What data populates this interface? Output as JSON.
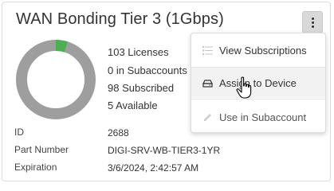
{
  "card": {
    "title": "WAN Bonding Tier 3 (1Gbps)"
  },
  "usage": {
    "total_licenses": 103,
    "subscribed": 98,
    "available": 5,
    "in_subaccounts": 0,
    "colors": {
      "used": "#9e9e9e",
      "available": "#4caf50"
    },
    "lines": [
      "103 Licenses",
      "0 in Subaccounts",
      "98 Subscribed",
      "5 Available"
    ]
  },
  "details": [
    {
      "label": "ID",
      "value": "2688"
    },
    {
      "label": "Part Number",
      "value": "DIGI-SRV-WB-TIER3-1YR"
    },
    {
      "label": "Expiration",
      "value": "3/6/2024, 2:42:57 AM"
    }
  ],
  "menu": {
    "items": [
      {
        "label": "View Subscriptions",
        "icon": "list-icon"
      },
      {
        "label": "Assign to Device",
        "icon": "device-icon"
      },
      {
        "label": "Use in Subaccount",
        "icon": "pencil-icon"
      }
    ]
  }
}
